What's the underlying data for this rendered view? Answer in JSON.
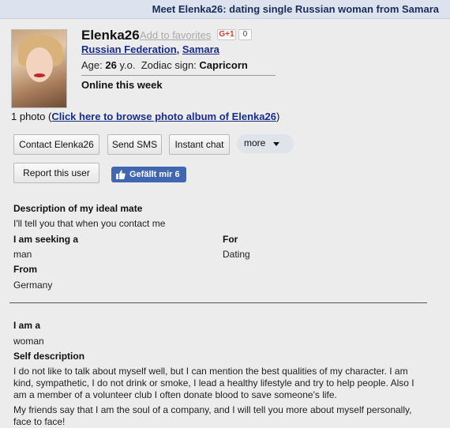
{
  "header": {
    "title": "Meet Elenka26: dating single Russian woman from Samara"
  },
  "profile": {
    "name": "Elenka26",
    "add_favorites": "Add to favorites",
    "gplus_label": "G+1",
    "gplus_count": "0",
    "country": "Russian Federation",
    "city": "Samara",
    "age_prefix": "Age:",
    "age_value": "26",
    "age_unit": "y.o.",
    "zodiac_prefix": "Zodiac sign:",
    "zodiac_value": "Capricorn",
    "status": "Online this week",
    "photo_count_text": "1 photo (",
    "album_link": "Click here to browse photo album of Elenka26",
    "album_close": ")"
  },
  "actions": {
    "contact": "Contact Elenka26",
    "sms": "Send SMS",
    "chat": "Instant chat",
    "more": "more",
    "report": "Report this user",
    "fb_like": "Gefällt mir 6"
  },
  "details": {
    "ideal_mate_label": "Description of my ideal mate",
    "ideal_mate_value": "I'll tell you that when you contact me",
    "seeking_label": "I am seeking a",
    "seeking_value": "man",
    "for_label": "For",
    "for_value": "Dating",
    "from_label": "From",
    "from_value": "Germany",
    "iam_label": "I am a",
    "iam_value": "woman",
    "self_desc_label": "Self description",
    "self_desc_p1": "I do not like to talk about myself well, but I can mention the best qualities of my character. I am kind, sympathetic, I do not drink or smoke, I lead a healthy lifestyle and try to help people. Also I am a member of a volunteer club I often donate blood to save someone's life.",
    "self_desc_p2": "My friends say that I am the soul of a company, and I will tell you more about myself personally, face to face!"
  },
  "colors": {
    "link": "#1a2d8a",
    "header_bg": "#dde3ee",
    "fb_blue": "#4267b2"
  }
}
